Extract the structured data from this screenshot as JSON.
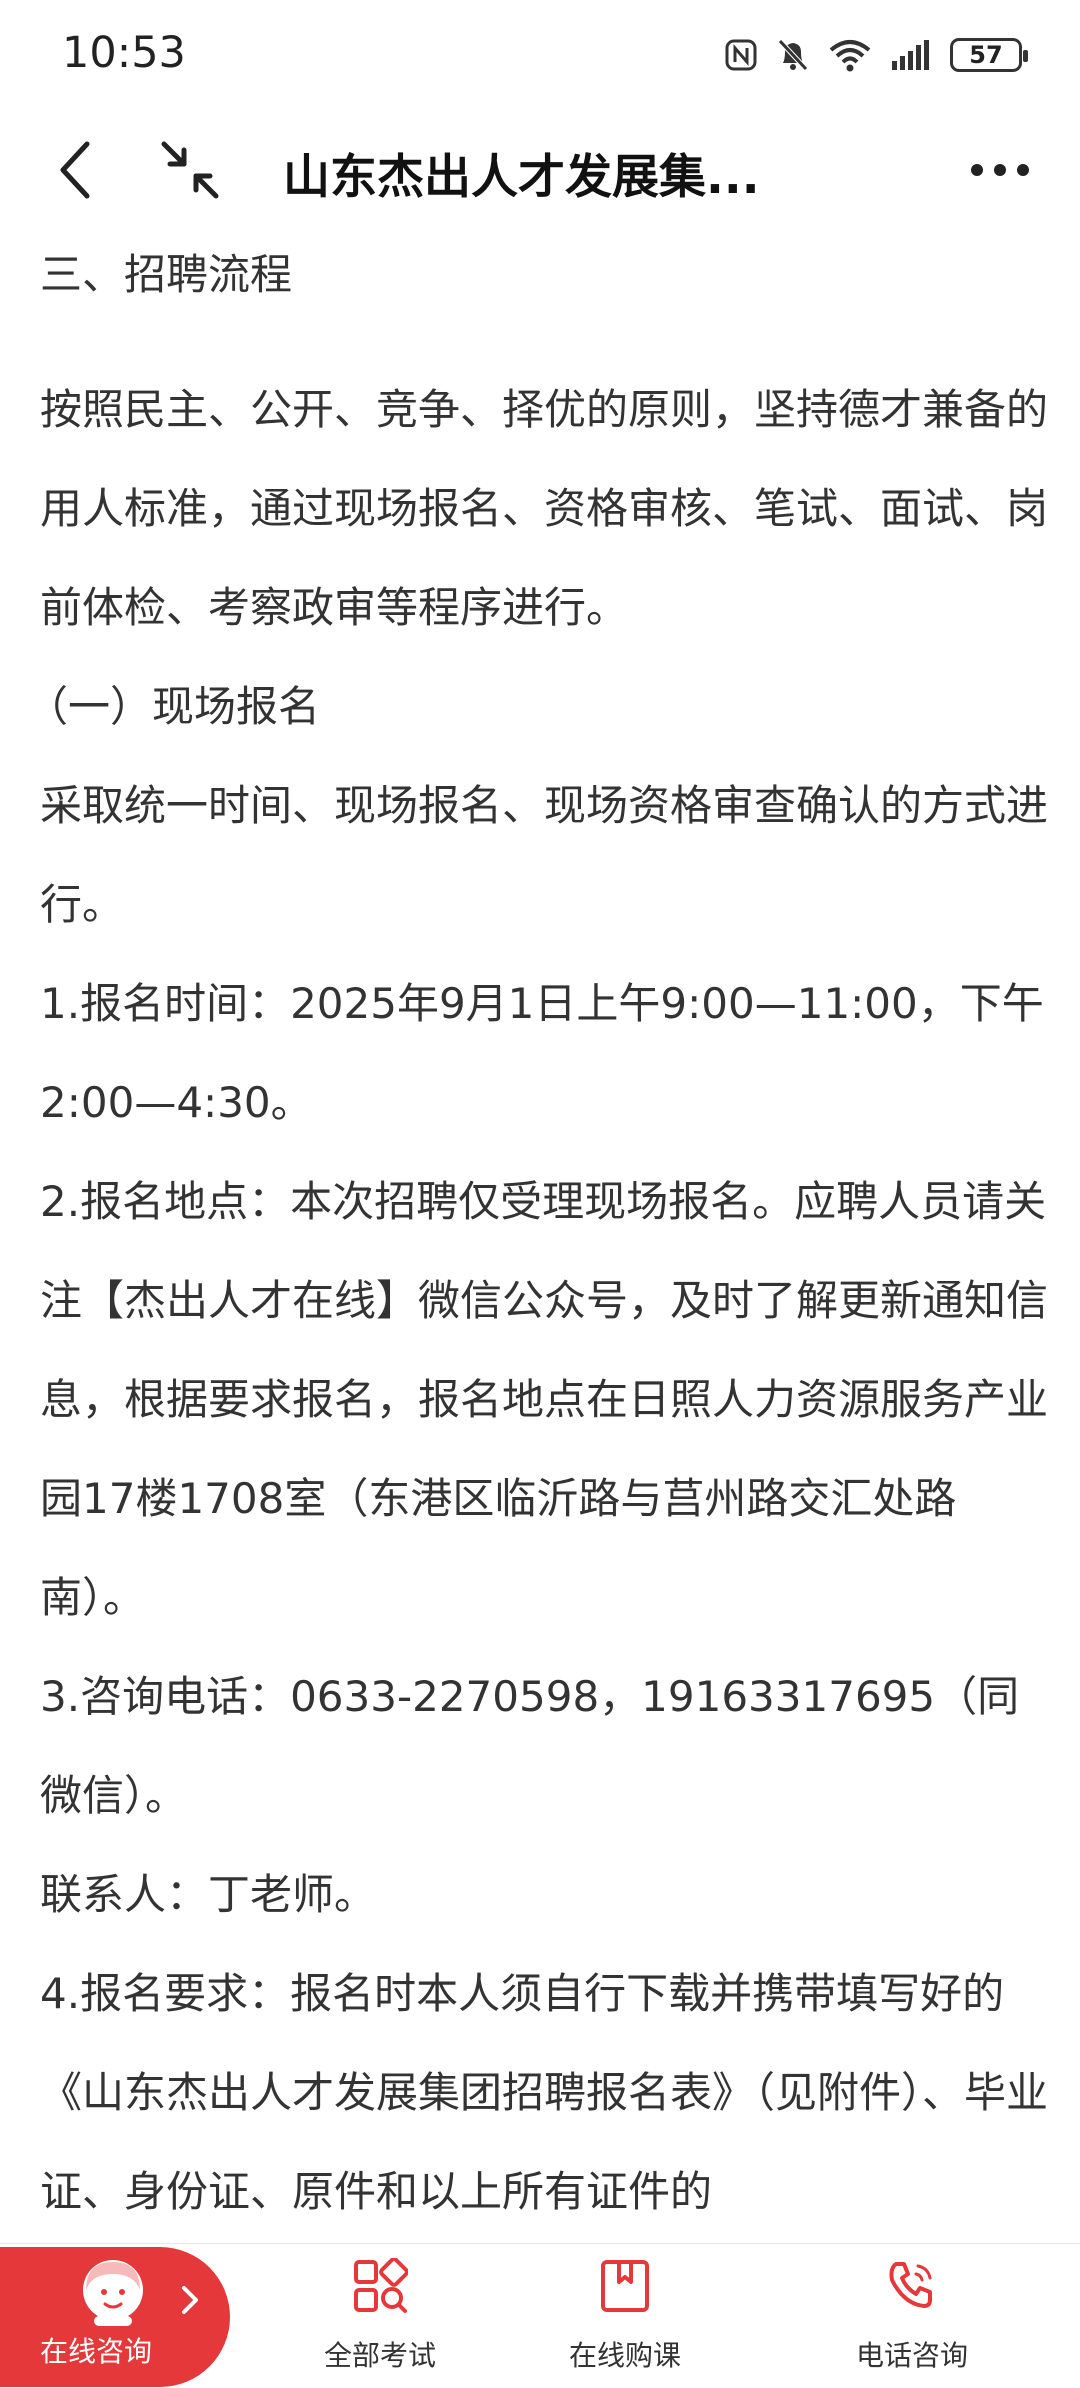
{
  "status_bar": {
    "time": "10:53",
    "battery": "57",
    "icons": [
      "nfc-icon",
      "bell-muted-icon",
      "wifi-icon",
      "signal-icon",
      "battery-icon"
    ]
  },
  "header": {
    "title": "山东杰出人才发展集...",
    "icons": [
      "back-arrow-icon",
      "shrink-icon",
      "more-icon"
    ]
  },
  "article": {
    "section_title": "三、招聘流程",
    "intro": "按照民主、公开、竞争、择优的原则，坚持德才兼备的用人标准，通过现场报名、资格审核、笔试、面试、岗前体检、考察政审等程序进行。",
    "subsection": "（一）现场报名",
    "sub_intro": "采取统一时间、现场报名、现场资格审查确认的方式进行。",
    "item1": "1.报名时间：2025年9月1日上午9:00—11:00，下午2:00—4:30。",
    "item2": "2.报名地点：本次招聘仅受理现场报名。应聘人员请关注【杰出人才在线】微信公众号，及时了解更新通知信息，根据要求报名，报名地点在日照人力资源服务产业园17楼1708室（东港区临沂路与莒州路交汇处路南）。",
    "item3": "3.咨询电话：0633-2270598，19163317695（同微信）。",
    "contact": "联系人：丁老师。",
    "item4": "4.报名要求：报名时本人须自行下载并携带填写好的《山东杰出人才发展集团招聘报名表》（见附件）、毕业证、身份证、原件和以上所有证件的"
  },
  "bottom_nav": {
    "consult": "在线咨询",
    "items": [
      {
        "label": "全部考试",
        "icon": "exams-grid-icon"
      },
      {
        "label": "在线购课",
        "icon": "course-book-icon"
      },
      {
        "label": "电话咨询",
        "icon": "phone-icon"
      }
    ]
  },
  "colors": {
    "accent": "#e5383b",
    "text": "#333333",
    "title": "#111111"
  }
}
